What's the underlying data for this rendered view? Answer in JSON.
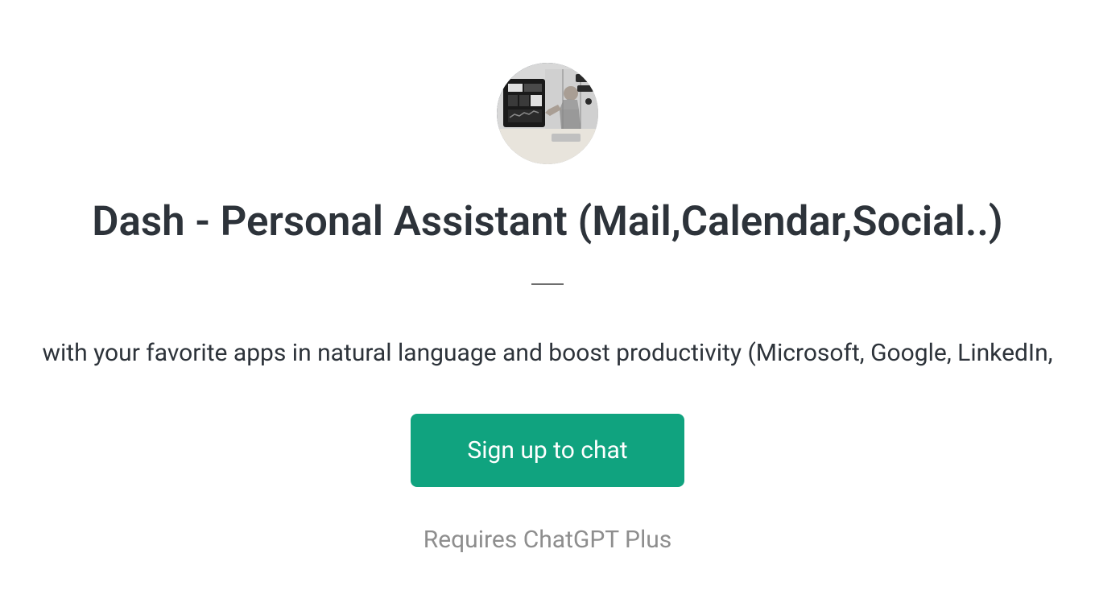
{
  "header": {
    "title": "Dash - Personal Assistant (Mail,Calendar,Social..)",
    "description": "with your favorite apps in natural language and boost productivity (Microsoft, Google, LinkedIn,"
  },
  "cta": {
    "signup_label": "Sign up to chat",
    "requires_label": "Requires ChatGPT Plus"
  }
}
